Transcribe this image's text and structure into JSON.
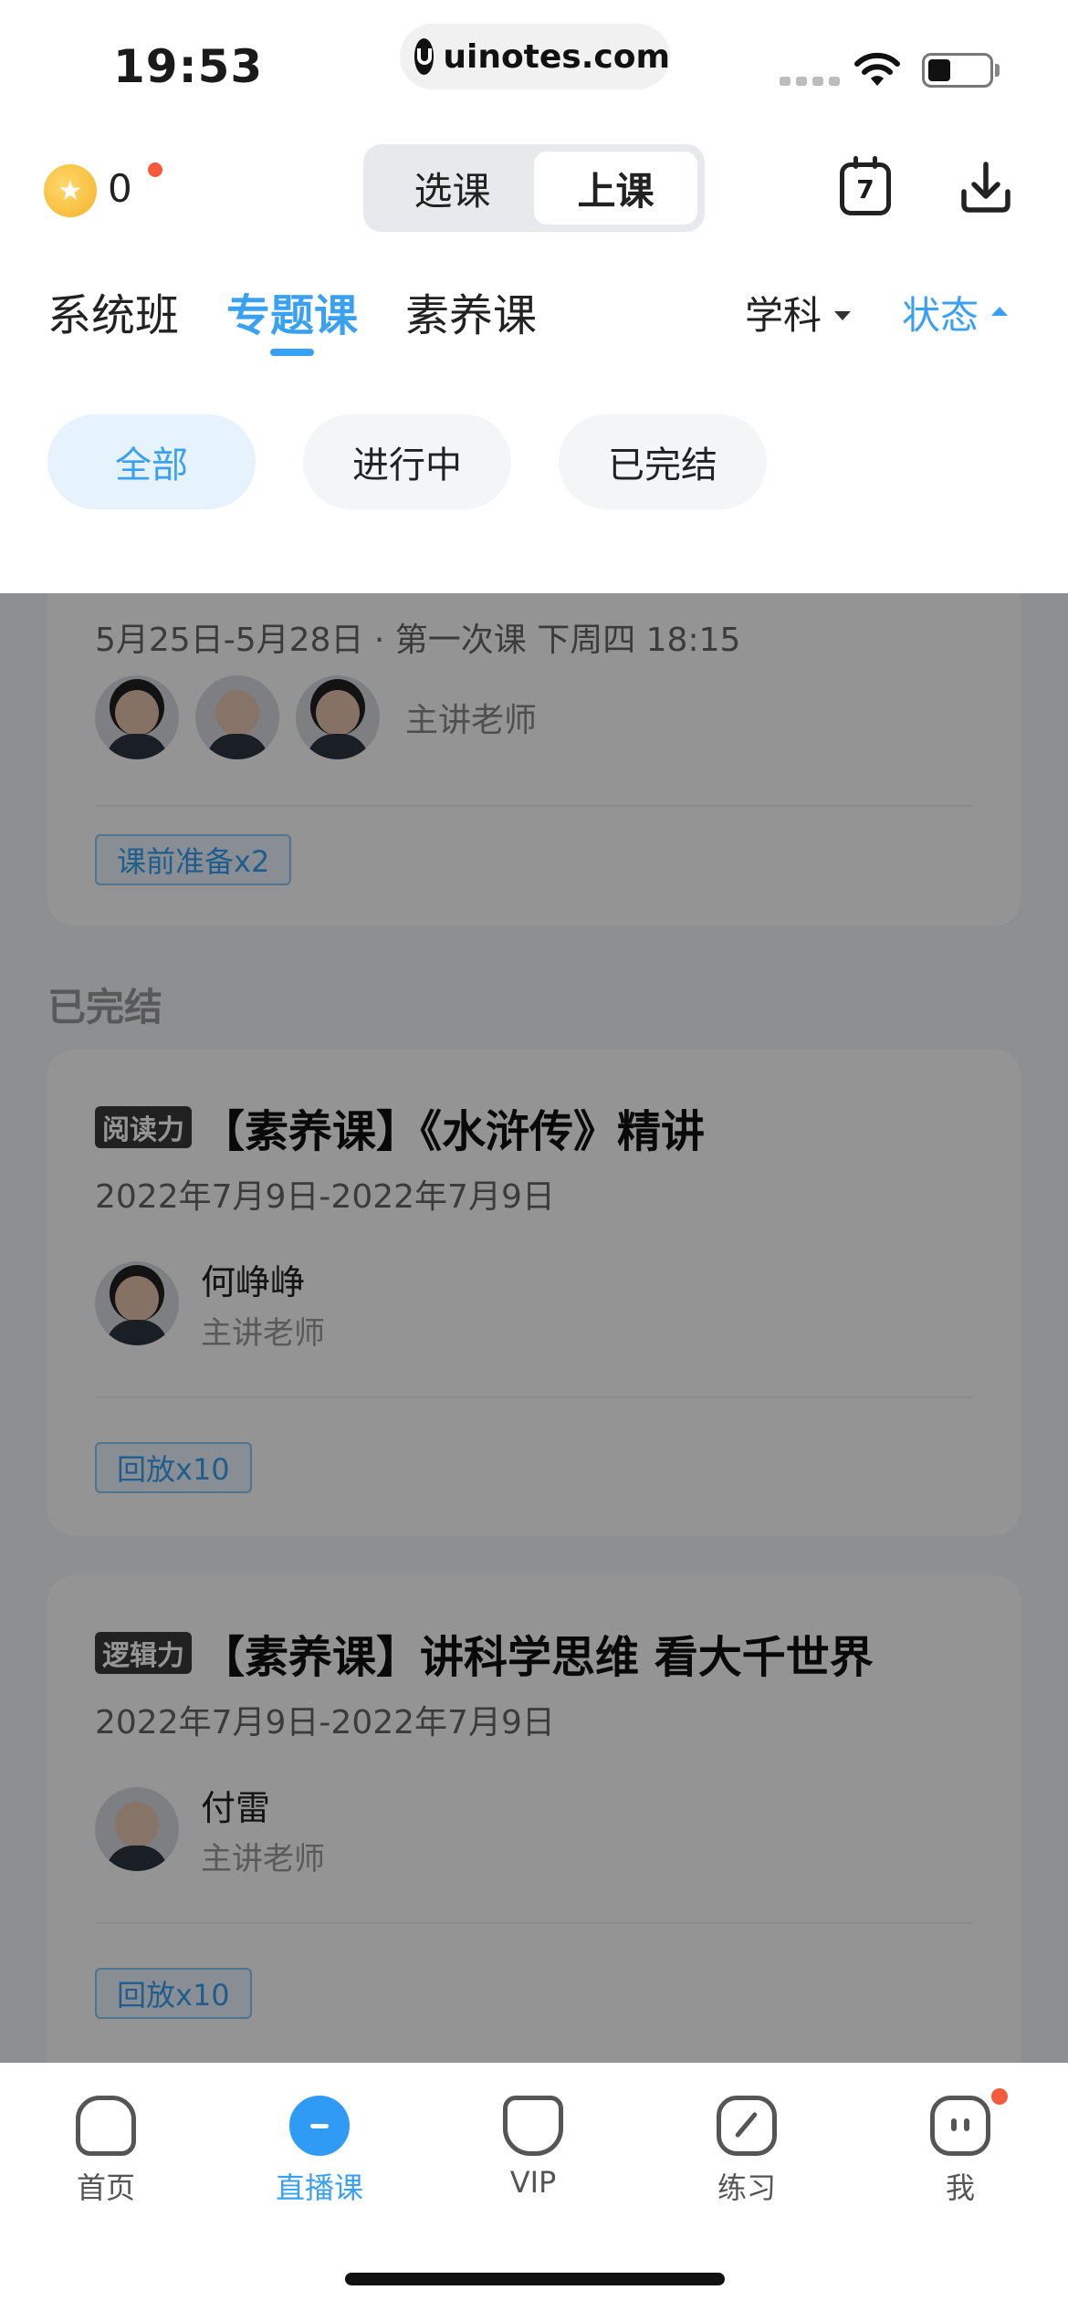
{
  "status_bar": {
    "time": "19:53",
    "url": "uinotes.com"
  },
  "header": {
    "coin_count": "0",
    "segments": [
      "选课",
      "上课"
    ],
    "active_segment": "上课",
    "calendar_day": "7"
  },
  "tabs": [
    "系统班",
    "专题课",
    "素养课"
  ],
  "active_tab": "专题课",
  "filters": {
    "subject": "学科",
    "status": "状态"
  },
  "chips": [
    "全部",
    "进行中",
    "已完结"
  ],
  "active_chip": "全部",
  "top_card": {
    "schedule": "5月25日-5月28日 · 第一次课 下周四 18:15",
    "teachers_label": "主讲老师",
    "tag": "课前准备x2"
  },
  "finished_section_title": "已完结",
  "finished_courses": [
    {
      "badge": "阅读力",
      "title": "【素养课】《水浒传》精讲",
      "date": "2022年7月9日-2022年7月9日",
      "teacher": "何峥峥",
      "teacher_role": "主讲老师",
      "tag": "回放x10"
    },
    {
      "badge": "逻辑力",
      "title": "【素养课】讲科学思维 看大千世界",
      "date": "2022年7月9日-2022年7月9日",
      "teacher": "付雷",
      "teacher_role": "主讲老师",
      "tag": "回放x10"
    }
  ],
  "bottom_nav": [
    {
      "label": "首页",
      "icon": "home-icon"
    },
    {
      "label": "直播课",
      "icon": "live-icon"
    },
    {
      "label": "VIP",
      "icon": "vip-icon"
    },
    {
      "label": "练习",
      "icon": "practice-icon"
    },
    {
      "label": "我",
      "icon": "me-icon"
    }
  ],
  "active_nav": "直播课",
  "colors": {
    "accent": "#3aa0f2",
    "notification_dot": "#f45b3c",
    "coin": "#f4b32a"
  }
}
